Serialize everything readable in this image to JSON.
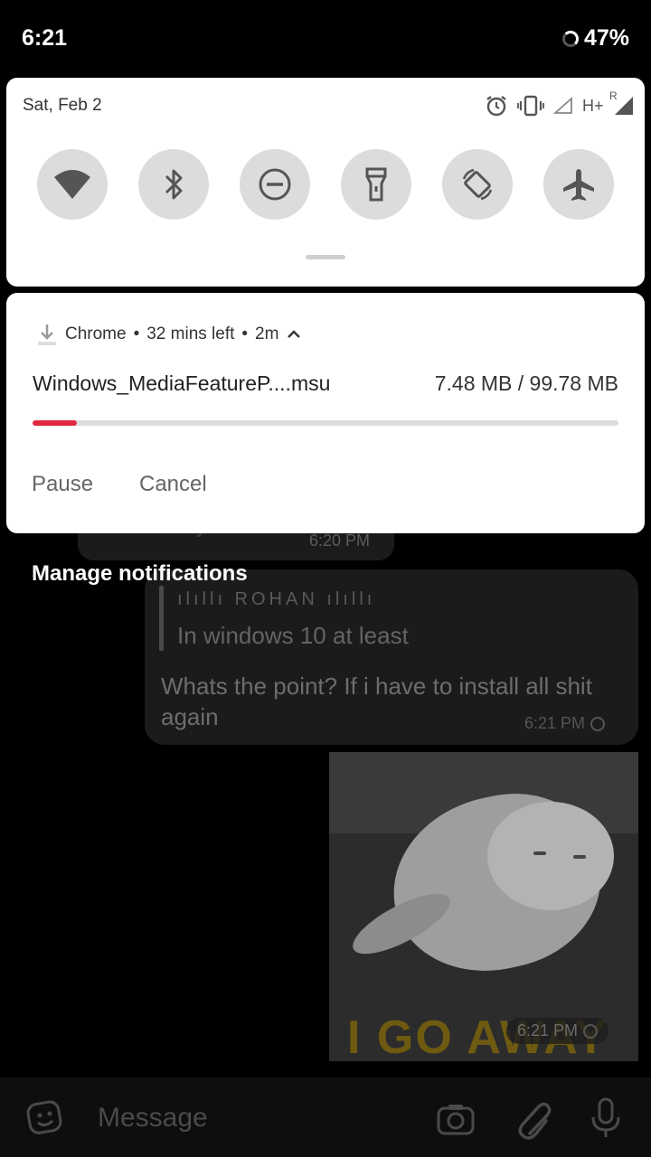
{
  "status_bar": {
    "time": "6:21",
    "battery": "47%"
  },
  "quick_settings": {
    "date": "Sat, Feb 2",
    "network_label": "H+",
    "roaming_label": "R",
    "tiles": [
      "wifi-icon",
      "bluetooth-icon",
      "dnd-icon",
      "flashlight-icon",
      "auto-rotate-icon",
      "airplane-icon"
    ]
  },
  "notification": {
    "app": "Chrome",
    "time_left": "32 mins left",
    "age": "2m",
    "filename": "Windows_MediaFeatureP....msu",
    "size": "7.48 MB / 99.78 MB",
    "progress": 0.075,
    "progress_color": "#e0283e",
    "pause_label": "Pause",
    "cancel_label": "Cancel"
  },
  "manage_label": "Manage notifications",
  "chat": {
    "partial_text": "War is easy",
    "partial_time": "6:20 PM",
    "quote_author": "ılıllı ROHAN ılıllı",
    "quote_text": "In windows 10 at least",
    "message": "Whats the point? If i have to install all shit again",
    "message_time": "6:21 PM",
    "photo_caption": "I GO AWAY",
    "photo_time": "6:21 PM",
    "composer_placeholder": "Message"
  }
}
